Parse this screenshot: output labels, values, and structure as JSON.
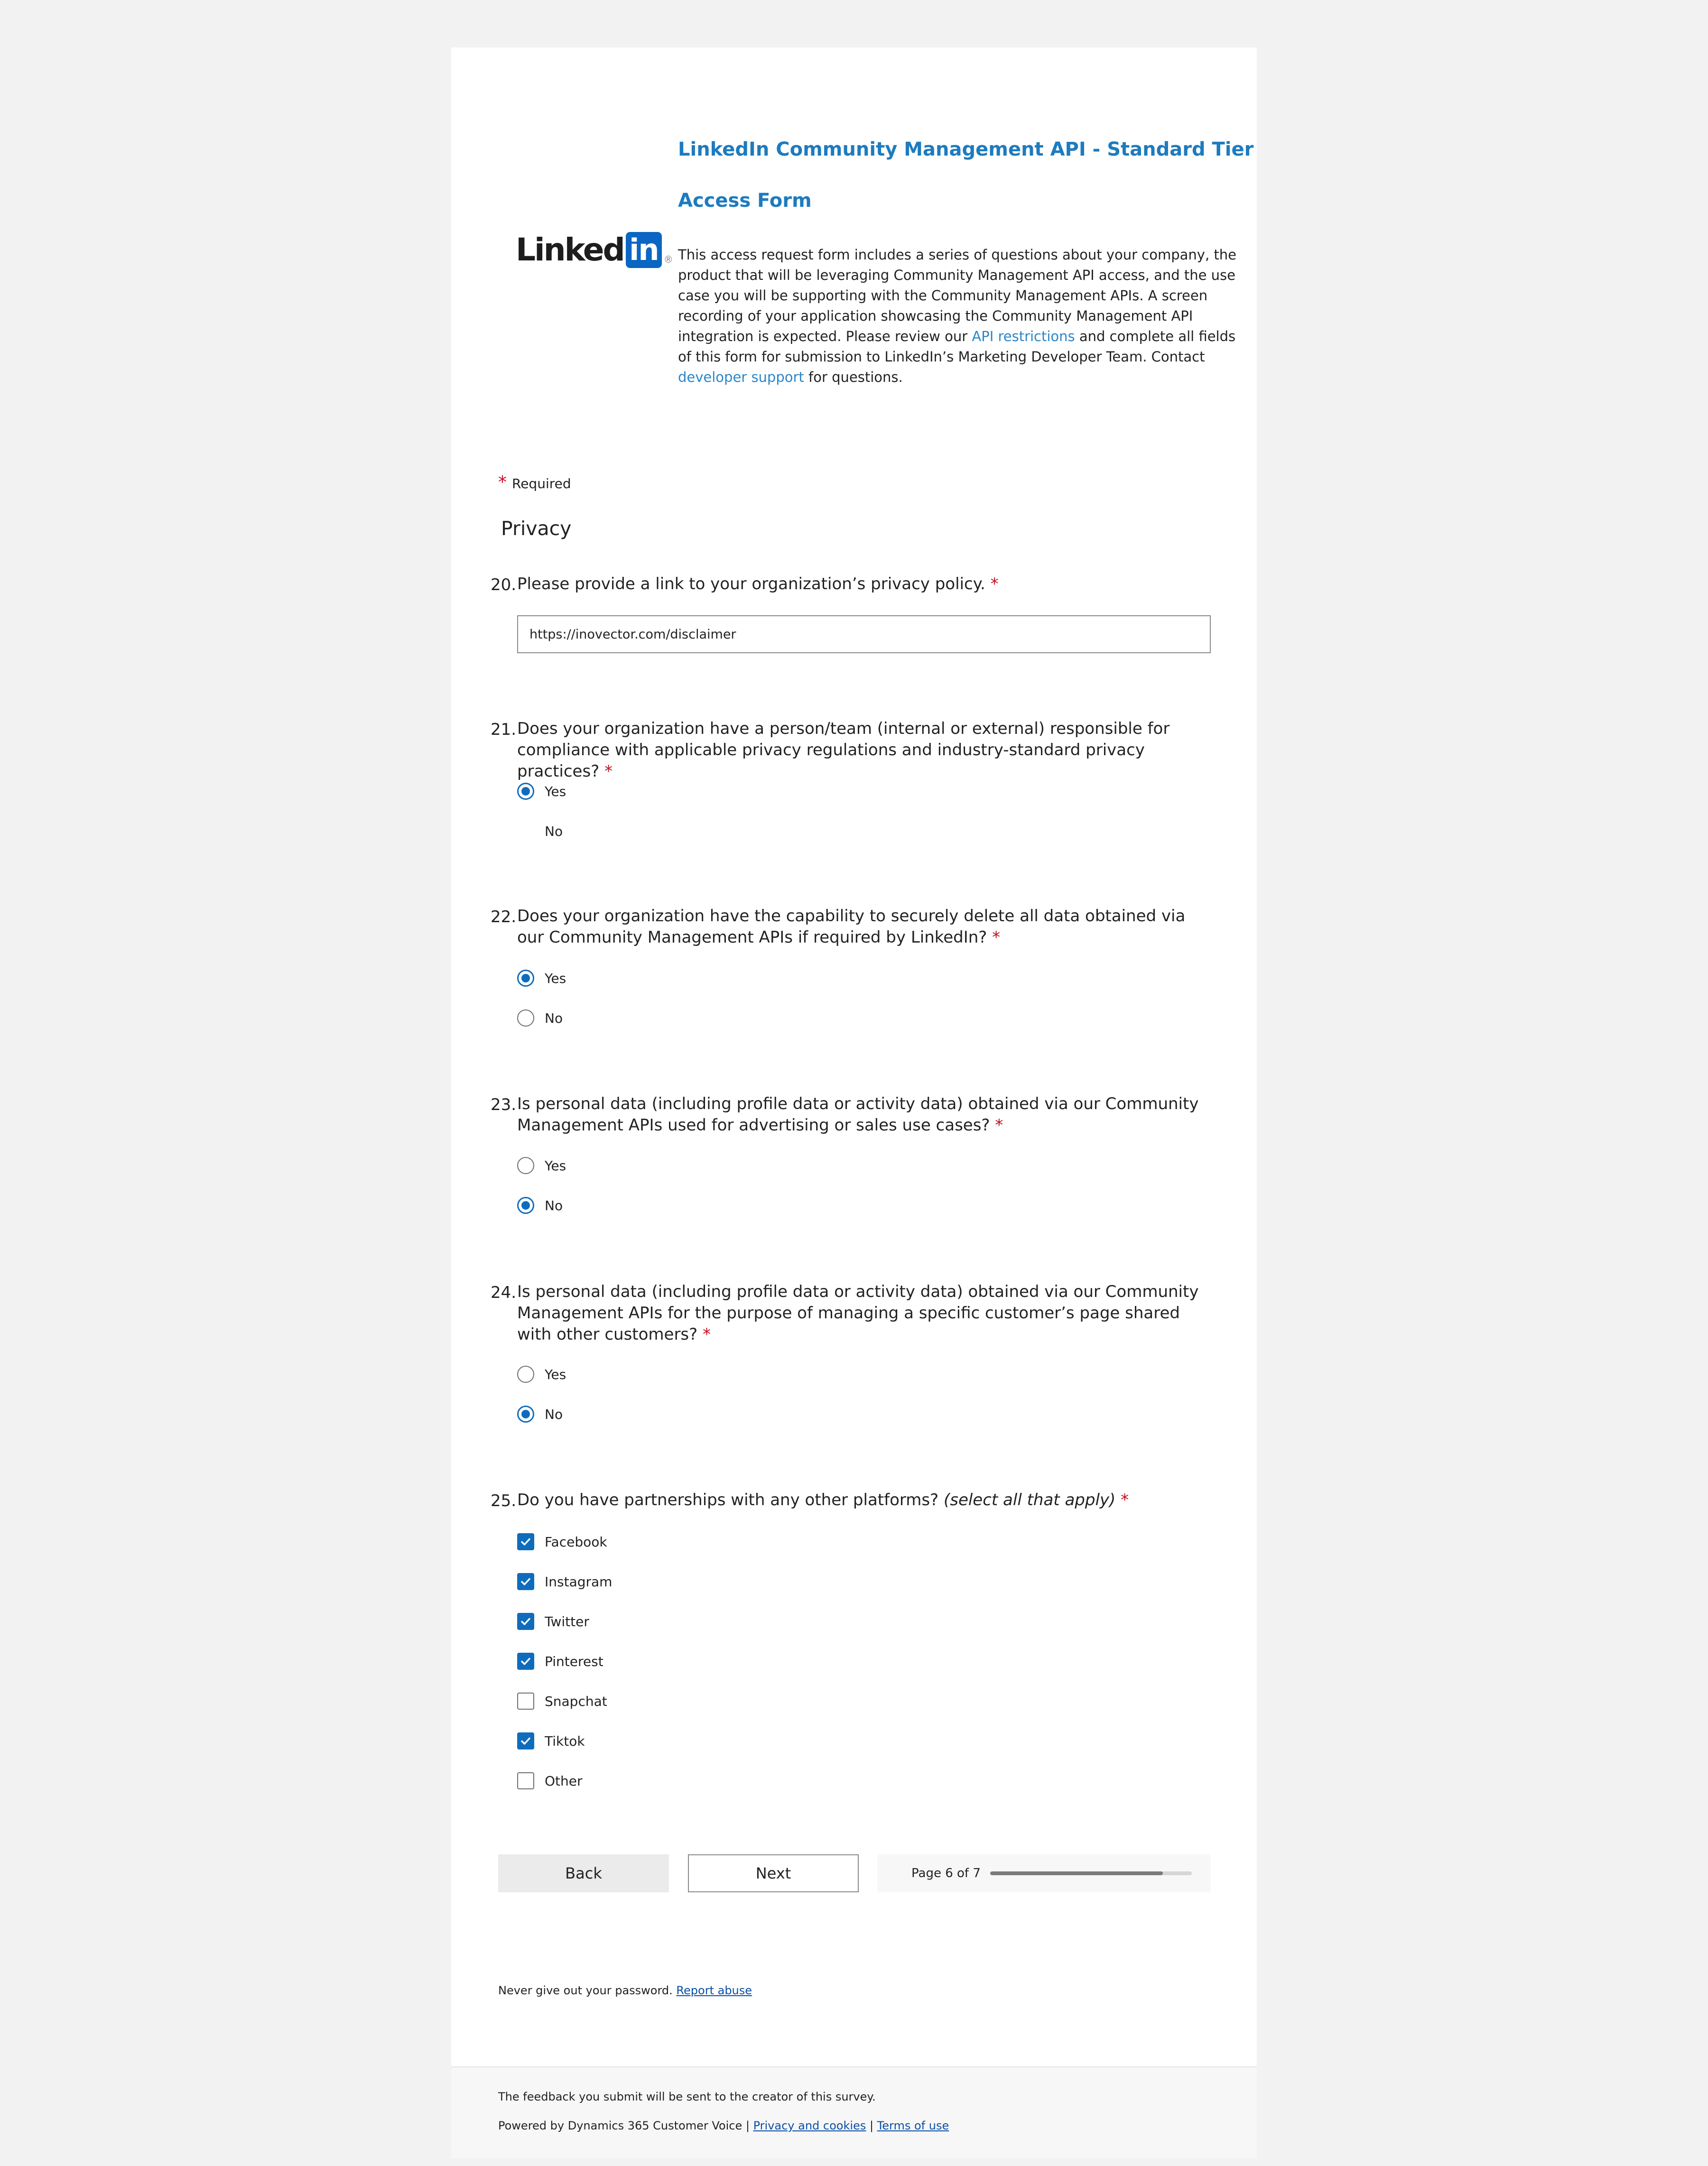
{
  "header": {
    "title_line1": "LinkedIn Community Management API - Standard Tier",
    "title_line2": "Access Form",
    "logo_text": "Linked",
    "logo_in": "in",
    "logo_reg": "®",
    "desc_part1": "This access request form includes a series of questions about your company, the product that will be leveraging Community Management API access, and the use case you will be supporting with the Community Management APIs. A screen recording of your application showcasing the Community Management API integration is expected. Please review our ",
    "desc_link1": "API restrictions",
    "desc_part2": " and complete all fields of this form for submission to LinkedIn’s Marketing Developer Team. Contact ",
    "desc_link2": "developer support",
    "desc_part3": " for questions."
  },
  "required": {
    "star": "*",
    "label": "Required"
  },
  "section": {
    "title": "Privacy"
  },
  "questions": {
    "q20": {
      "number": "20.",
      "text": "Please provide a link to your organization’s privacy policy.",
      "star": "*",
      "value": "https://inovector.com/disclaimer"
    },
    "q21": {
      "number": "21.",
      "text": "Does your organization have a person/team (internal or external) responsible for compliance with applicable privacy regulations and industry-standard privacy practices?",
      "star": "*",
      "options": [
        "Yes",
        "No"
      ],
      "selected": "Yes"
    },
    "q22": {
      "number": "22.",
      "text": "Does your organization have the capability to securely delete all data obtained via our Community Management APIs if required by LinkedIn?",
      "star": "*",
      "options": [
        "Yes",
        "No"
      ],
      "selected": "Yes"
    },
    "q23": {
      "number": "23.",
      "text": "Is personal data (including profile data or activity data) obtained via our Community Management APIs used for advertising or sales use cases?",
      "star": "*",
      "options": [
        "Yes",
        "No"
      ],
      "selected": "No"
    },
    "q24": {
      "number": "24.",
      "text": "Is personal data (including profile data or activity data) obtained via our Community Management APIs for the purpose of managing a specific customer’s page shared with other customers?",
      "star": "*",
      "options": [
        "Yes",
        "No"
      ],
      "selected": "No"
    },
    "q25": {
      "number": "25.",
      "text": "Do you have partnerships with any other platforms?",
      "hint": "(select all that apply)",
      "star": "*",
      "options": [
        "Facebook",
        "Instagram",
        "Twitter",
        "Pinterest",
        "Snapchat",
        "Tiktok",
        "Other"
      ],
      "checked": [
        true,
        true,
        true,
        true,
        false,
        true,
        false
      ]
    }
  },
  "nav": {
    "back_label": "Back",
    "next_label": "Next",
    "page_label": "Page 6 of 7",
    "progress_fraction": 0.857
  },
  "notice": {
    "text": "Never give out your password.",
    "link": "Report abuse"
  },
  "footer": {
    "line1": "The feedback you submit will be sent to the creator of this survey.",
    "powered": "Powered by Dynamics 365 Customer Voice",
    "sep": "|",
    "privacy": "Privacy and cookies",
    "terms": "Terms of use"
  },
  "colors": {
    "accent": "#0f6cbd",
    "title": "#1d7bbf",
    "required": "#c50f1f",
    "logo": "#0a66c2"
  }
}
